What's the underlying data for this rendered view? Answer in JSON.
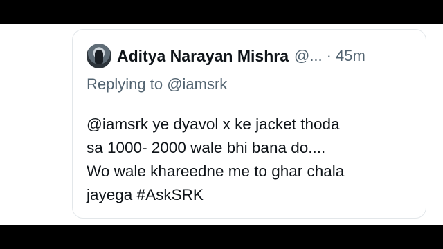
{
  "tweet": {
    "author_name": "Aditya Narayan Mishra",
    "author_handle": "@...",
    "separator": "·",
    "time": "45m",
    "replying_prefix": "Replying to",
    "replying_to": "@iamsrk",
    "lines": [
      "@iamsrk ye dyavol x  ke jacket thoda",
      "sa 1000- 2000 wale bhi bana do....",
      "Wo wale khareedne me to ghar chala",
      "jayega #AskSRK"
    ]
  },
  "colors": {
    "text_primary": "#0f1419",
    "text_secondary": "#536471",
    "card_border": "#e3e7ea",
    "letterbox": "#000000"
  },
  "icons": {
    "avatar": "user-avatar-photo"
  }
}
